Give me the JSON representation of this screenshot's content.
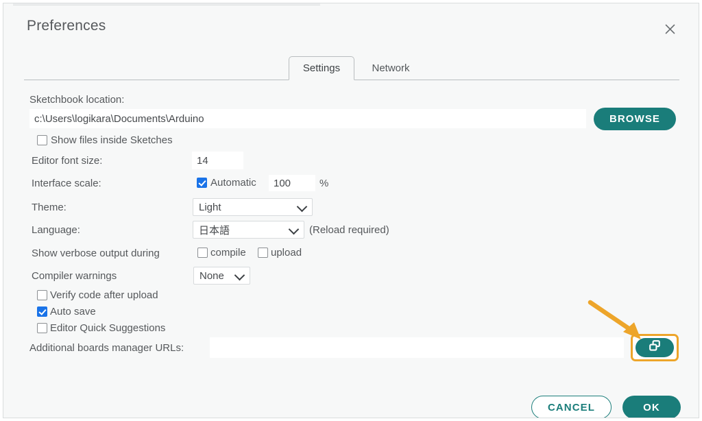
{
  "window": {
    "title": "Preferences",
    "close_icon": "close-icon"
  },
  "tabs": [
    {
      "label": "Settings",
      "active": true
    },
    {
      "label": "Network",
      "active": false
    }
  ],
  "form": {
    "sketchbook_location_label": "Sketchbook location:",
    "sketchbook_location_value": "c:\\Users\\logikara\\Documents\\Arduino",
    "browse_button": "BROWSE",
    "show_files_inside_sketches_label": "Show files inside Sketches",
    "show_files_inside_sketches_checked": false,
    "editor_font_size_label": "Editor font size:",
    "editor_font_size_value": "14",
    "interface_scale_label": "Interface scale:",
    "interface_scale_automatic_label": "Automatic",
    "interface_scale_automatic_checked": true,
    "interface_scale_value": "100",
    "interface_scale_unit": "%",
    "theme_label": "Theme:",
    "theme_value": "Light",
    "language_label": "Language:",
    "language_value": "日本語",
    "language_note": "(Reload required)",
    "verbose_output_label": "Show verbose output during",
    "verbose_compile_label": "compile",
    "verbose_compile_checked": false,
    "verbose_upload_label": "upload",
    "verbose_upload_checked": false,
    "compiler_warnings_label": "Compiler warnings",
    "compiler_warnings_value": "None",
    "verify_code_after_upload_label": "Verify code after upload",
    "verify_code_after_upload_checked": false,
    "auto_save_label": "Auto save",
    "auto_save_checked": true,
    "editor_quick_suggestions_label": "Editor Quick Suggestions",
    "editor_quick_suggestions_checked": false,
    "additional_urls_label": "Additional boards manager URLs:",
    "additional_urls_value": "",
    "additional_urls_edit_icon": "overlapping-windows-icon"
  },
  "footer": {
    "cancel_button": "CANCEL",
    "ok_button": "OK"
  },
  "annotation": {
    "arrow_icon": "arrow-pointing-down-right-icon",
    "arrow_color": "#eda52a",
    "highlight_color": "#eda52a"
  },
  "colors": {
    "accent_teal": "#1a7d7a",
    "checkbox_blue": "#1a73e8",
    "dialog_background": "#f7f8f8",
    "text_primary": "#55585b"
  }
}
